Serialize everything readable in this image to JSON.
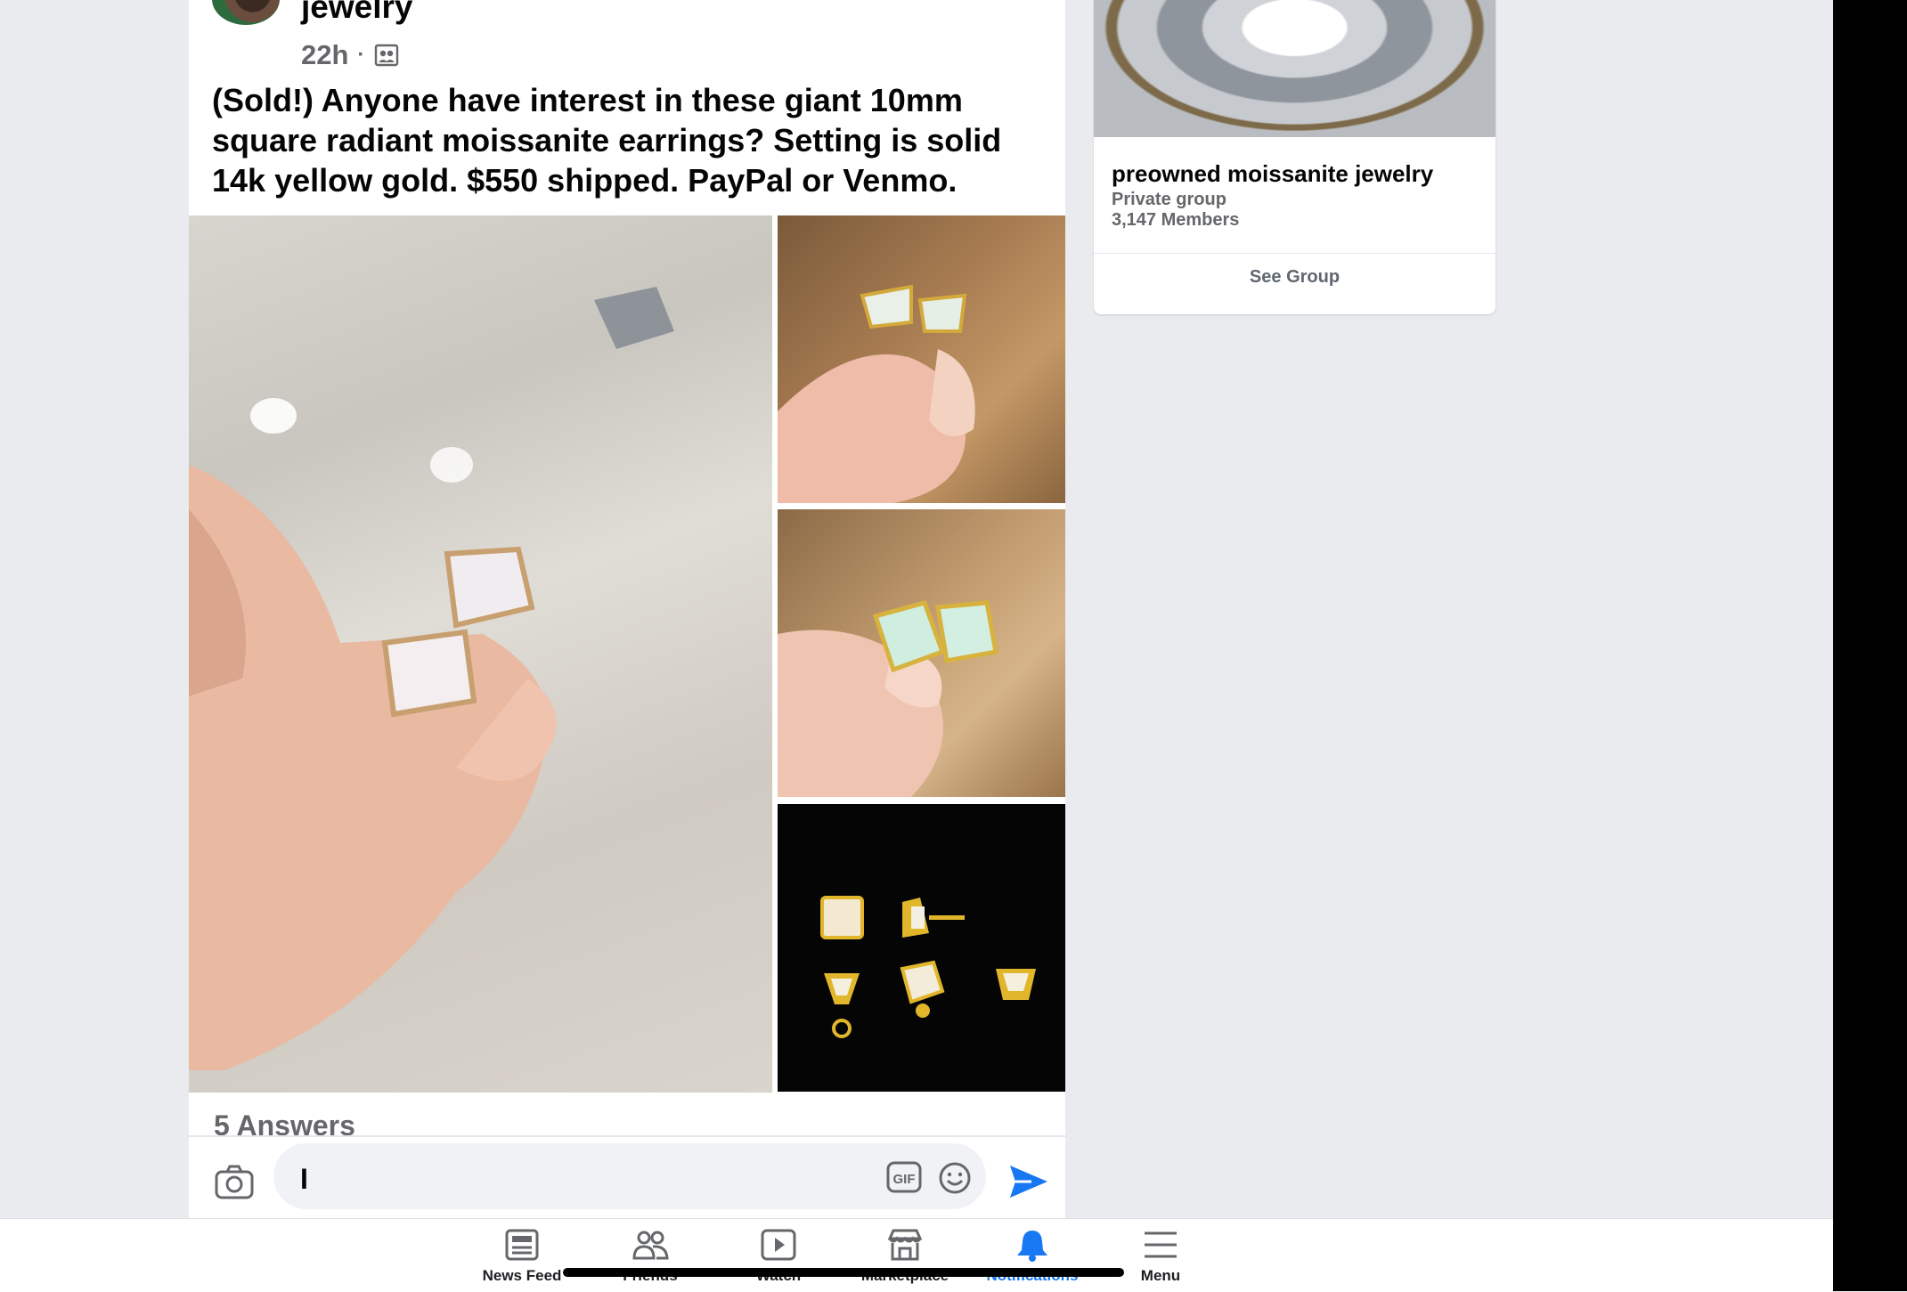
{
  "post": {
    "group_name": "jewelry",
    "time": "22h",
    "separator": "·",
    "privacy_icon": "group-privacy-icon",
    "text": "(Sold!) Anyone have interest in these giant 10mm square radiant moissanite earrings? Setting is solid 14k yellow gold. $550 shipped. PayPal or Venmo.",
    "answers_label": "5 Answers",
    "photos": [
      "earrings-hand-marble",
      "earrings-gold-wood",
      "earrings-bezel-wood",
      "earrings-cad-render"
    ]
  },
  "comment_bar": {
    "typed_value": "I",
    "camera_icon": "camera-icon",
    "gif_icon": "gif-icon",
    "emoji_icon": "emoji-icon",
    "send_icon": "send-icon"
  },
  "sidebar_group": {
    "name": "preowned moissanite jewelry",
    "type": "Private group",
    "members": "3,147 Members",
    "button": "See Group"
  },
  "tab_bar": {
    "tabs": [
      {
        "label": "News Feed",
        "icon": "news-feed-icon",
        "active": false
      },
      {
        "label": "Friends",
        "icon": "friends-icon",
        "active": false
      },
      {
        "label": "Watch",
        "icon": "watch-icon",
        "active": false
      },
      {
        "label": "Marketplace",
        "icon": "marketplace-icon",
        "active": false
      },
      {
        "label": "Notifications",
        "icon": "bell-icon",
        "active": true
      },
      {
        "label": "Menu",
        "icon": "menu-icon",
        "active": false
      }
    ]
  },
  "colors": {
    "accent": "#1877f2",
    "page_bg": "#e9ebee",
    "secondary_text": "#65676b"
  }
}
